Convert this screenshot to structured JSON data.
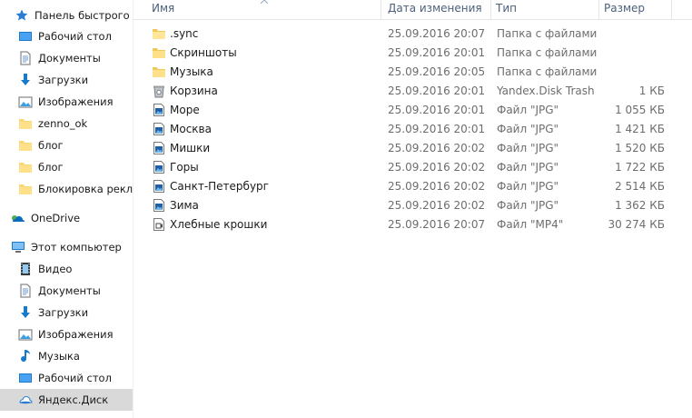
{
  "nav": {
    "quick_access_label": "Панель быстрого до",
    "quick_items": [
      {
        "label": "Рабочий стол",
        "icon": "desktop-icon",
        "pinned": true
      },
      {
        "label": "Документы",
        "icon": "documents-icon",
        "pinned": true
      },
      {
        "label": "Загрузки",
        "icon": "downloads-icon",
        "pinned": true
      },
      {
        "label": "Изображения",
        "icon": "pictures-icon",
        "pinned": true
      },
      {
        "label": "zenno_ok",
        "icon": "folder-icon",
        "pinned": false
      },
      {
        "label": "блог",
        "icon": "folder-icon",
        "pinned": false
      },
      {
        "label": "блог",
        "icon": "folder-icon",
        "pinned": false
      },
      {
        "label": "Блокировка рекла",
        "icon": "folder-icon",
        "pinned": false
      }
    ],
    "onedrive_label": "OneDrive",
    "this_pc_label": "Этот компьютер",
    "pc_items": [
      {
        "label": "Видео",
        "icon": "video-icon"
      },
      {
        "label": "Документы",
        "icon": "documents-icon"
      },
      {
        "label": "Загрузки",
        "icon": "downloads-icon"
      },
      {
        "label": "Изображения",
        "icon": "pictures-icon"
      },
      {
        "label": "Музыка",
        "icon": "music-icon"
      },
      {
        "label": "Рабочий стол",
        "icon": "desktop-icon"
      },
      {
        "label": "Яндекс.Диск",
        "icon": "yandex-disk-icon",
        "selected": true
      }
    ]
  },
  "columns": {
    "name": "Имя",
    "date": "Дата изменения",
    "type": "Тип",
    "size": "Размер"
  },
  "files": [
    {
      "name": ".sync",
      "date": "25.09.2016 20:07",
      "type": "Папка с файлами",
      "size": "",
      "icon": "folder-icon"
    },
    {
      "name": "Скриншоты",
      "date": "25.09.2016 20:01",
      "type": "Папка с файлами",
      "size": "",
      "icon": "folder-icon"
    },
    {
      "name": "Музыка",
      "date": "25.09.2016 20:05",
      "type": "Папка с файлами",
      "size": "",
      "icon": "folder-icon"
    },
    {
      "name": "Корзина",
      "date": "25.09.2016 20:01",
      "type": "Yandex.Disk Trash",
      "size": "1 КБ",
      "icon": "trash-icon"
    },
    {
      "name": "Море",
      "date": "25.09.2016 20:01",
      "type": "Файл \"JPG\"",
      "size": "1 055 КБ",
      "icon": "image-file-icon"
    },
    {
      "name": "Москва",
      "date": "25.09.2016 20:01",
      "type": "Файл \"JPG\"",
      "size": "1 421 КБ",
      "icon": "image-file-icon"
    },
    {
      "name": "Мишки",
      "date": "25.09.2016 20:02",
      "type": "Файл \"JPG\"",
      "size": "1 520 КБ",
      "icon": "image-file-icon"
    },
    {
      "name": "Горы",
      "date": "25.09.2016 20:02",
      "type": "Файл \"JPG\"",
      "size": "1 722 КБ",
      "icon": "image-file-icon"
    },
    {
      "name": "Санкт-Петербург",
      "date": "25.09.2016 20:02",
      "type": "Файл \"JPG\"",
      "size": "2 514 КБ",
      "icon": "image-file-icon"
    },
    {
      "name": "Зима",
      "date": "25.09.2016 20:02",
      "type": "Файл \"JPG\"",
      "size": "1 362 КБ",
      "icon": "image-file-icon"
    },
    {
      "name": "Хлебные крошки",
      "date": "25.09.2016 20:07",
      "type": "Файл \"MP4\"",
      "size": "30 274 КБ",
      "icon": "video-file-icon"
    }
  ],
  "colors": {
    "folder": "#f8d775",
    "header_text": "#4c607a",
    "selected_bg": "#d9d9d9",
    "accent_blue": "#1979ca"
  }
}
